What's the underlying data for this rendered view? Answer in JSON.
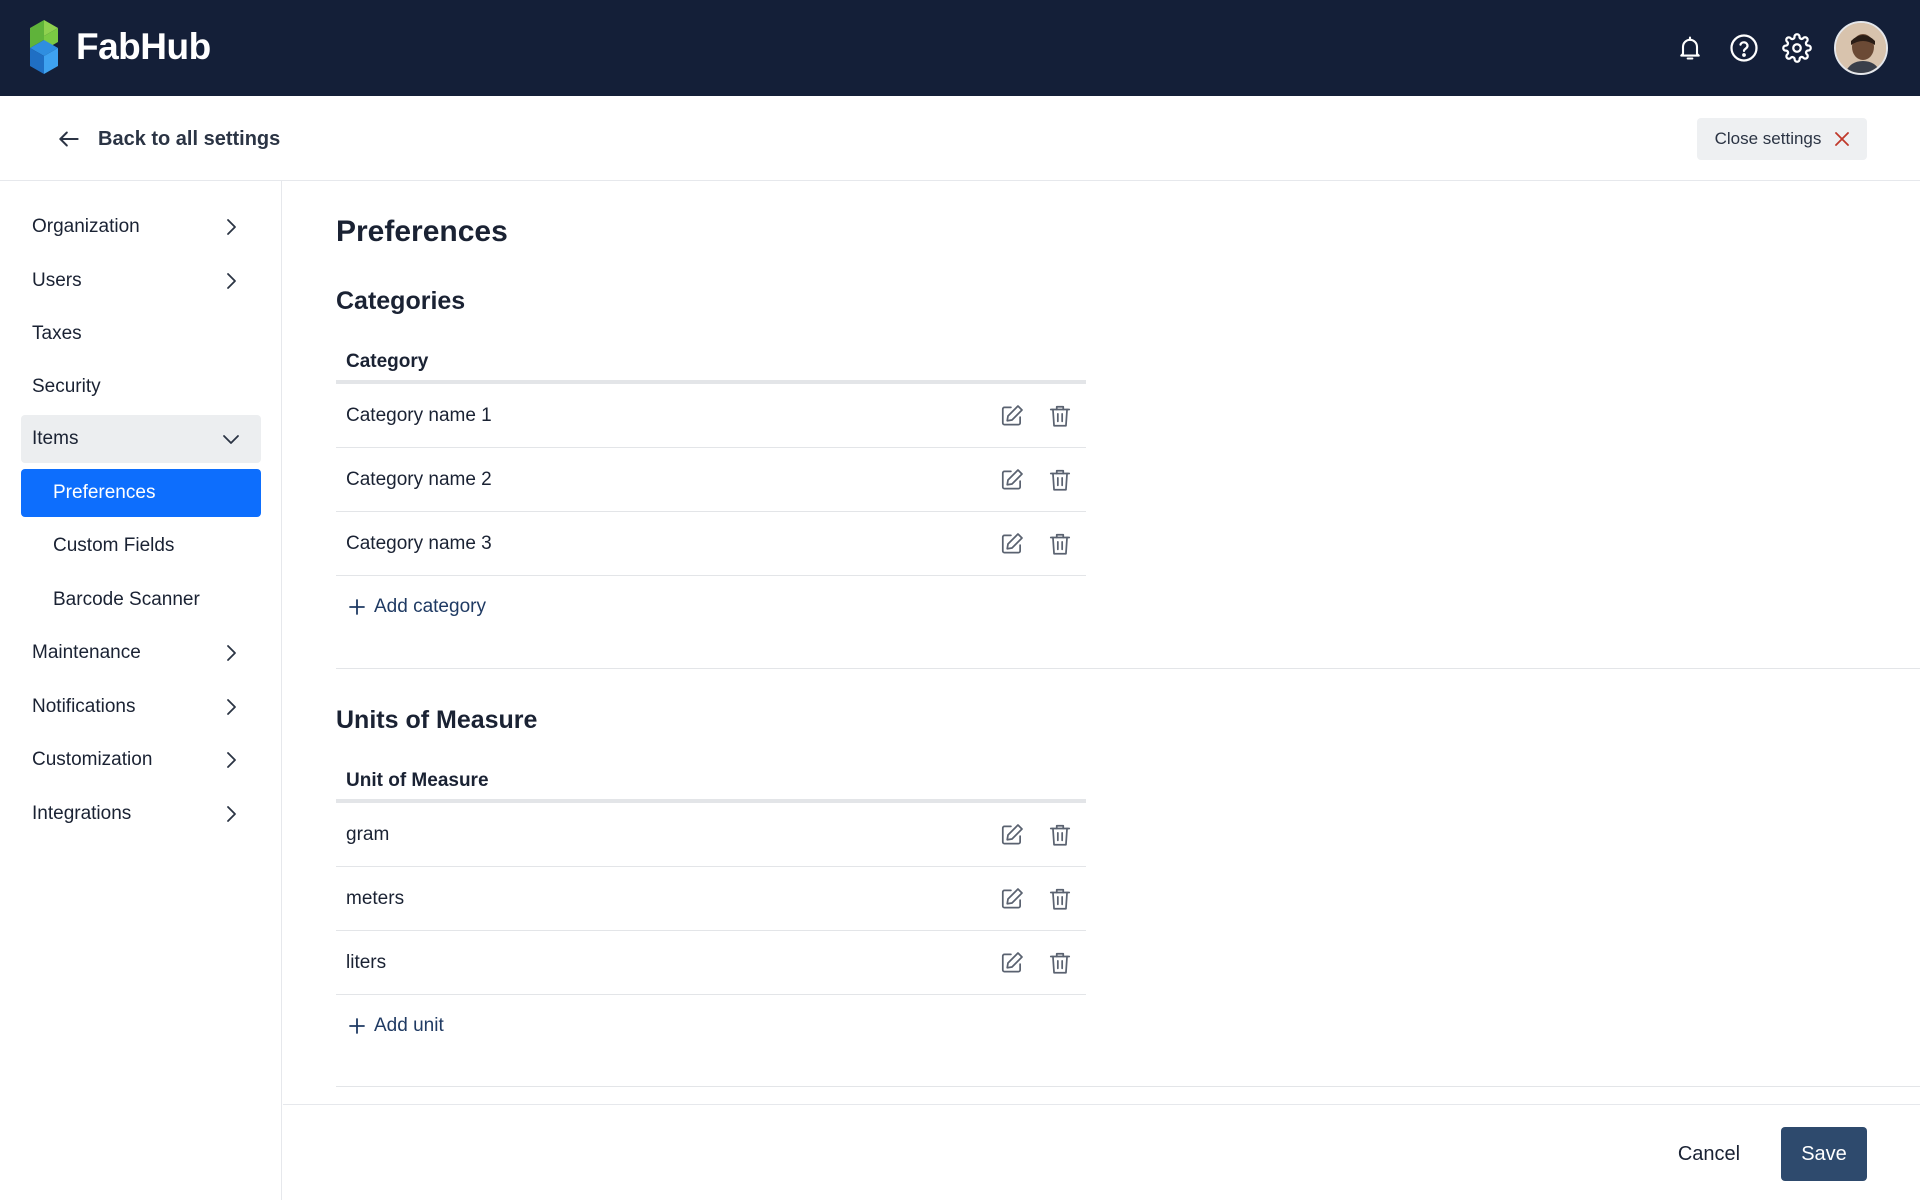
{
  "header": {
    "app_name": "FabHub",
    "icons": [
      "bell-icon",
      "help-icon",
      "gear-icon"
    ],
    "brand_colors": {
      "bar": "#141f38",
      "logo_green": "#7ac943",
      "logo_blue": "#2f8ee0"
    }
  },
  "subheader": {
    "back_label": "Back to all settings",
    "close_label": "Close settings"
  },
  "sidebar": {
    "items": [
      {
        "label": "Organization",
        "has_chevron": true
      },
      {
        "label": "Users",
        "has_chevron": true
      },
      {
        "label": "Taxes",
        "has_chevron": false
      },
      {
        "label": "Security",
        "has_chevron": false
      },
      {
        "label": "Items",
        "expanded": true
      },
      {
        "label": "Preferences",
        "sub": true,
        "active": true
      },
      {
        "label": "Custom Fields",
        "sub": true
      },
      {
        "label": "Barcode Scanner",
        "sub": true
      },
      {
        "label": "Maintenance",
        "has_chevron": true
      },
      {
        "label": "Notifications",
        "has_chevron": true
      },
      {
        "label": "Customization",
        "has_chevron": true
      },
      {
        "label": "Integrations",
        "has_chevron": true
      }
    ],
    "active_color": "#0d6efd"
  },
  "main": {
    "title": "Preferences",
    "categories": {
      "title": "Categories",
      "column": "Category",
      "rows": [
        "Category name 1",
        "Category name 2",
        "Category name 3"
      ],
      "add_label": "Add category"
    },
    "units": {
      "title": "Units of Measure",
      "column": "Unit of Measure",
      "rows": [
        "gram",
        "meters",
        "liters"
      ],
      "add_label": "Add unit"
    }
  },
  "footer": {
    "cancel_label": "Cancel",
    "save_label": "Save",
    "save_color": "#2e4a6d"
  }
}
